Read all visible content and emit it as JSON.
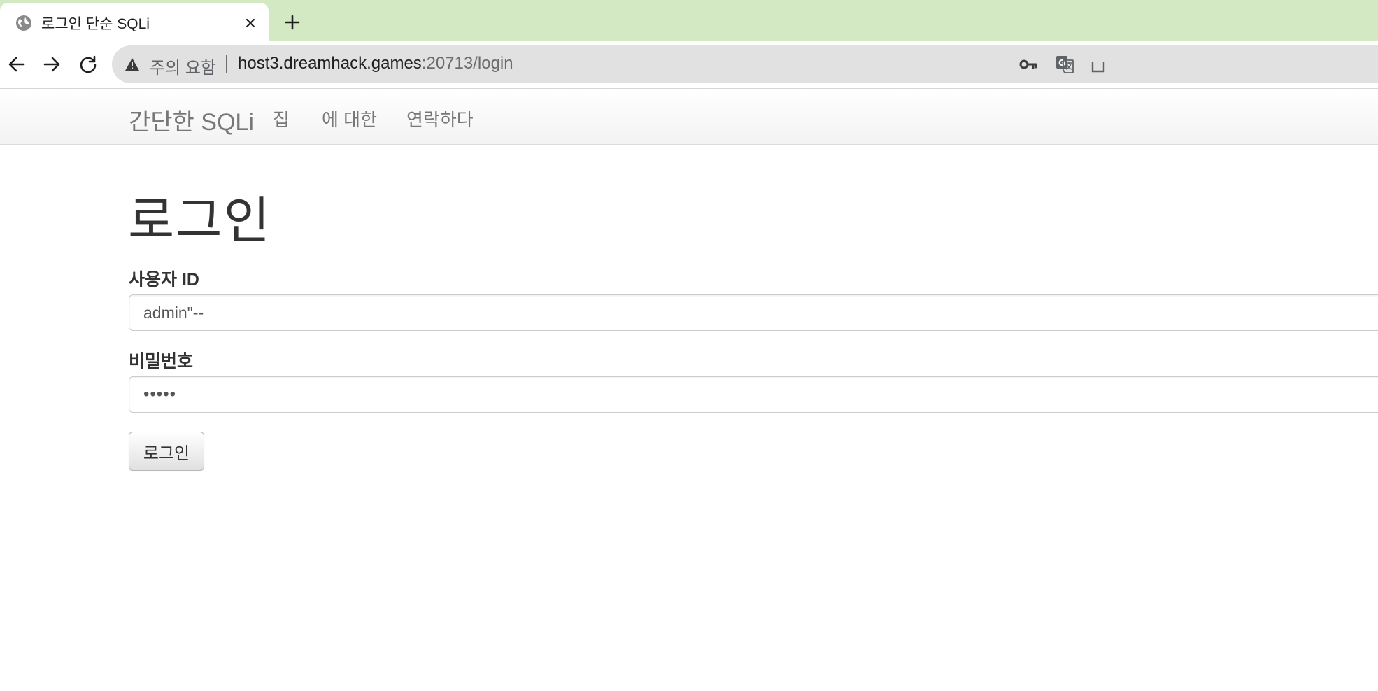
{
  "browser": {
    "tab": {
      "title": "로그인 단순 SQLi",
      "favicon": "globe-icon"
    },
    "toolbar": {
      "security_label": "주의 요함",
      "url_host": "host3.dreamhack.games",
      "url_rest": ":20713/login",
      "icons": [
        "back-arrow-icon",
        "forward-arrow-icon",
        "reload-icon",
        "warning-icon",
        "key-icon",
        "translate-icon",
        "share-icon"
      ]
    },
    "colors": {
      "tabstrip": "#d3e9c4",
      "omnibox": "#e1e1e1"
    }
  },
  "site": {
    "brand": "간단한 SQLi",
    "nav": [
      {
        "label": "집"
      },
      {
        "label": "에 대한"
      },
      {
        "label": "연락하다"
      }
    ]
  },
  "login": {
    "title": "로그인",
    "userid": {
      "label": "사용자 ID",
      "value": "admin\"--"
    },
    "password": {
      "label": "비밀번호",
      "display": "•••••"
    },
    "submit_label": "로그인"
  }
}
